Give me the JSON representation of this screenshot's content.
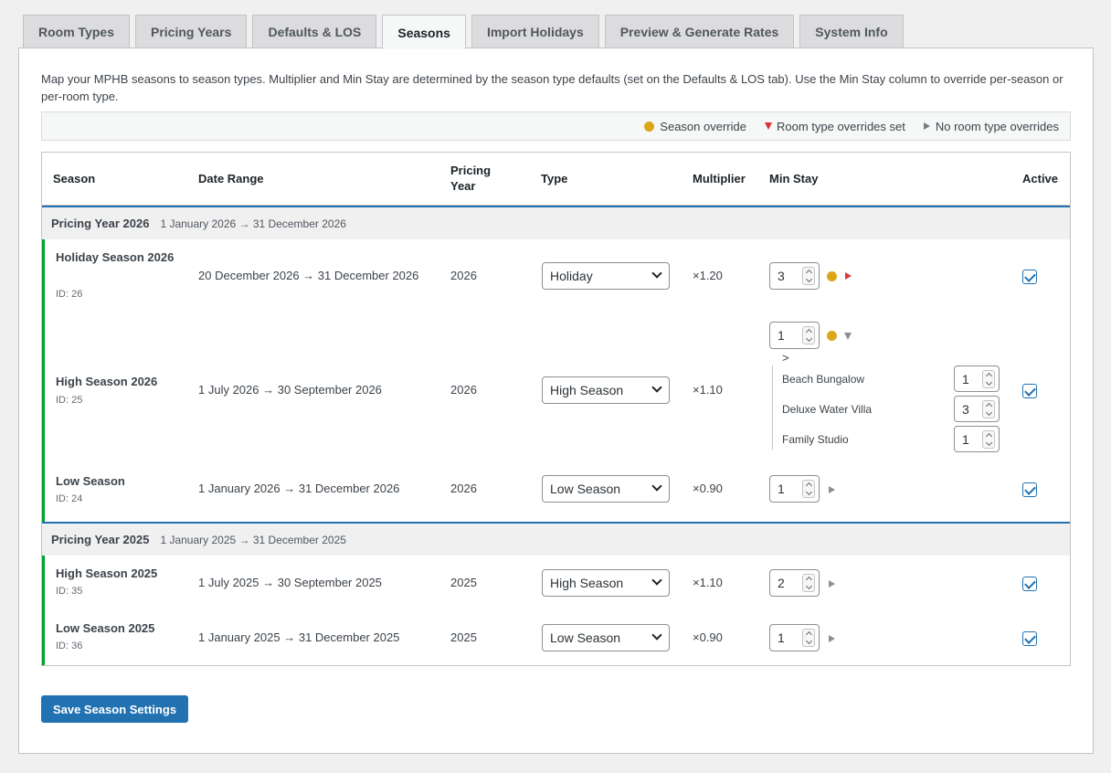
{
  "tabs": [
    "Room Types",
    "Pricing Years",
    "Defaults & LOS",
    "Seasons",
    "Import Holidays",
    "Preview & Generate Rates",
    "System Info"
  ],
  "active_tab": "Seasons",
  "intro": "Map your MPHB seasons to season types. Multiplier and Min Stay are determined by the season type defaults (set on the Defaults & LOS tab). Use the Min Stay column to override per-season or per-room type.",
  "legend": {
    "season_override": "Season override",
    "room_type_overrides": "Room type overrides set",
    "no_room_type_overrides": "No room type overrides"
  },
  "columns": {
    "season": "Season",
    "date_range": "Date Range",
    "pricing_year": "Pricing Year",
    "type": "Type",
    "multiplier": "Multiplier",
    "min_stay": "Min Stay",
    "active": "Active"
  },
  "groups": [
    {
      "title": "Pricing Year 2026",
      "range": "1 January 2026 → 31 December 2026",
      "rows": [
        {
          "name": "Holiday Season 2026",
          "id": "ID: 26",
          "date_range": "20 December 2026 → 31 December 2026",
          "year": "2026",
          "type": "Holiday",
          "multiplier": "×1.20",
          "min_stay": "3",
          "season_override": true,
          "room_overrides": "set-collapsed",
          "active": true
        },
        {
          "name": "High Season 2026",
          "id": "ID: 25",
          "date_range": "1 July 2026 → 30 September 2026",
          "year": "2026",
          "type": "High Season",
          "multiplier": "×1.10",
          "min_stay": "1",
          "season_override": true,
          "room_overrides": "expanded",
          "active": true,
          "room_types_toggle": ">",
          "room_types": [
            {
              "name": "Beach Bungalow",
              "value": "1"
            },
            {
              "name": "Deluxe Water Villa",
              "value": "3"
            },
            {
              "name": "Family Studio",
              "value": "1"
            }
          ]
        },
        {
          "name": "Low Season",
          "id": "ID: 24",
          "date_range": "1 January 2026 → 31 December 2026",
          "year": "2026",
          "type": "Low Season",
          "multiplier": "×0.90",
          "min_stay": "1",
          "season_override": false,
          "room_overrides": "none",
          "active": true
        }
      ]
    },
    {
      "title": "Pricing Year 2025",
      "range": "1 January 2025 → 31 December 2025",
      "rows": [
        {
          "name": "High Season 2025",
          "id": "ID: 35",
          "date_range": "1 July 2025 → 30 September 2025",
          "year": "2025",
          "type": "High Season",
          "multiplier": "×1.10",
          "min_stay": "2",
          "season_override": false,
          "room_overrides": "none",
          "active": true
        },
        {
          "name": "Low Season 2025",
          "id": "ID: 36",
          "date_range": "1 January 2025 → 31 December 2025",
          "year": "2025",
          "type": "Low Season",
          "multiplier": "×0.90",
          "min_stay": "1",
          "season_override": false,
          "room_overrides": "none",
          "active": true
        }
      ]
    }
  ],
  "save_button": "Save Season Settings",
  "colors": {
    "accent": "#2271b1",
    "season_dot": "#dba617",
    "override_red": "#d63638",
    "active_bar": "#00a32a"
  }
}
